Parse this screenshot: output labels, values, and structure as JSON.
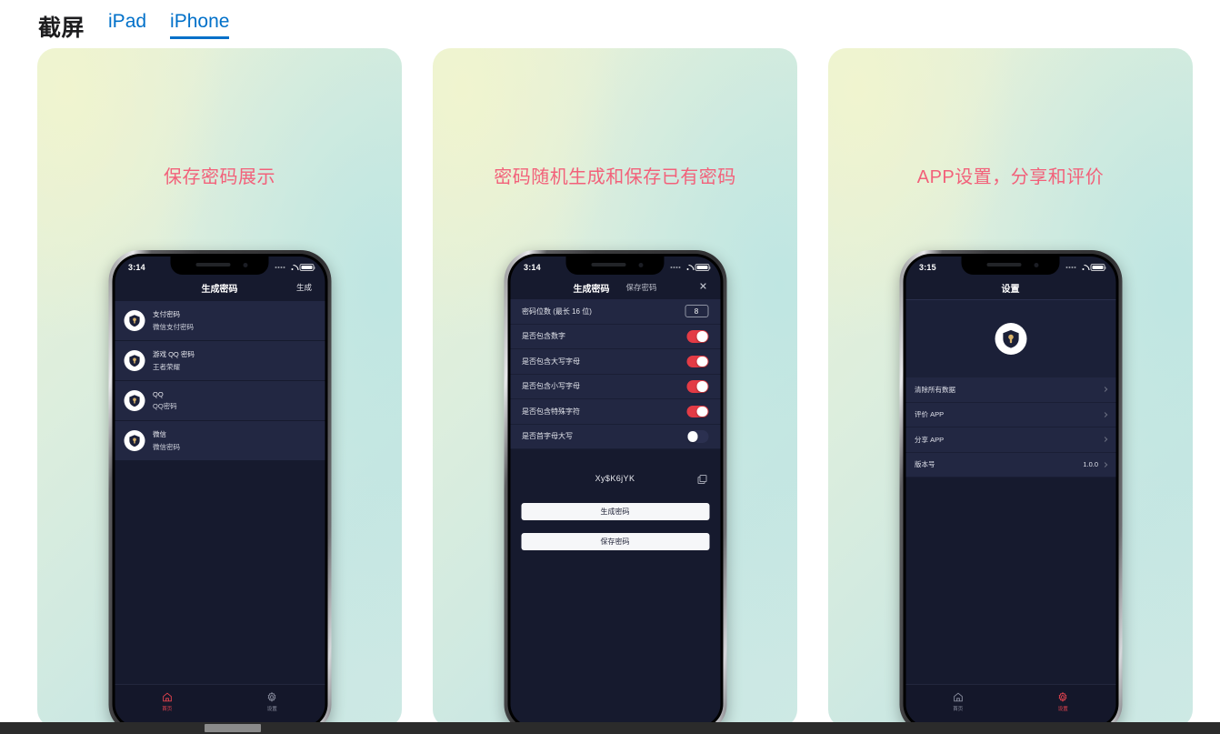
{
  "header": {
    "title": "截屏",
    "tabs": [
      {
        "label": "iPad",
        "active": false
      },
      {
        "label": "iPhone",
        "active": true
      }
    ]
  },
  "shots": [
    {
      "caption": "保存密码展示",
      "status": {
        "time": "3:14",
        "wifi": "wifi-icon",
        "battery": "battery-icon"
      },
      "nav": {
        "title": "生成密码",
        "right": "生成"
      },
      "list": [
        {
          "icon": "key-shield-icon",
          "title": "支付密码",
          "sub": "微信支付密码"
        },
        {
          "icon": "key-shield-icon",
          "title": "游戏 QQ 密码",
          "sub": "王者荣耀"
        },
        {
          "icon": "key-shield-icon",
          "title": "QQ",
          "sub": "QQ密码"
        },
        {
          "icon": "key-shield-icon",
          "title": "微信",
          "sub": "微信密码"
        }
      ],
      "tabbar": [
        {
          "icon": "home-icon",
          "label": "首页",
          "active": true
        },
        {
          "icon": "gear-icon",
          "label": "设置",
          "active": false
        }
      ]
    },
    {
      "caption": "密码随机生成和保存已有密码",
      "status": {
        "time": "3:14",
        "wifi": "wifi-icon",
        "battery": "battery-icon"
      },
      "nav": {
        "seg_active": "生成密码",
        "seg_inactive": "保存密码",
        "close": "close-icon"
      },
      "settings": [
        {
          "label": "密码位数 (最长 16 位)",
          "control": "number",
          "value": "8"
        },
        {
          "label": "是否包含数字",
          "control": "switch",
          "on": true
        },
        {
          "label": "是否包含大写字母",
          "control": "switch",
          "on": true
        },
        {
          "label": "是否包含小写字母",
          "control": "switch",
          "on": true
        },
        {
          "label": "是否包含特殊字符",
          "control": "switch",
          "on": true
        },
        {
          "label": "是否首字母大写",
          "control": "switch",
          "on": false
        }
      ],
      "password": {
        "value": "Xy$K6jYK",
        "copy": "copy-icon"
      },
      "buttons": [
        {
          "label": "生成密码"
        },
        {
          "label": "保存密码"
        }
      ]
    },
    {
      "caption": "APP设置，分享和评价",
      "status": {
        "time": "3:15",
        "wifi": "wifi-icon",
        "battery": "battery-icon"
      },
      "nav": {
        "title": "设置"
      },
      "app_icon": "key-shield-icon",
      "rows": [
        {
          "label": "清除所有数据",
          "value": "",
          "chevron": true
        },
        {
          "label": "评价 APP",
          "value": "",
          "chevron": true
        },
        {
          "label": "分享 APP",
          "value": "",
          "chevron": true
        },
        {
          "label": "版本号",
          "value": "1.0.0",
          "chevron": true
        }
      ],
      "tabbar": [
        {
          "icon": "home-icon",
          "label": "首页",
          "active": false
        },
        {
          "icon": "gear-icon",
          "label": "设置",
          "active": true
        }
      ]
    }
  ],
  "colors": {
    "link": "#0070c9",
    "caption": "#f2617a",
    "accent_red": "#e33b45",
    "screen_bg": "#161a2e",
    "row_bg": "#222742"
  }
}
